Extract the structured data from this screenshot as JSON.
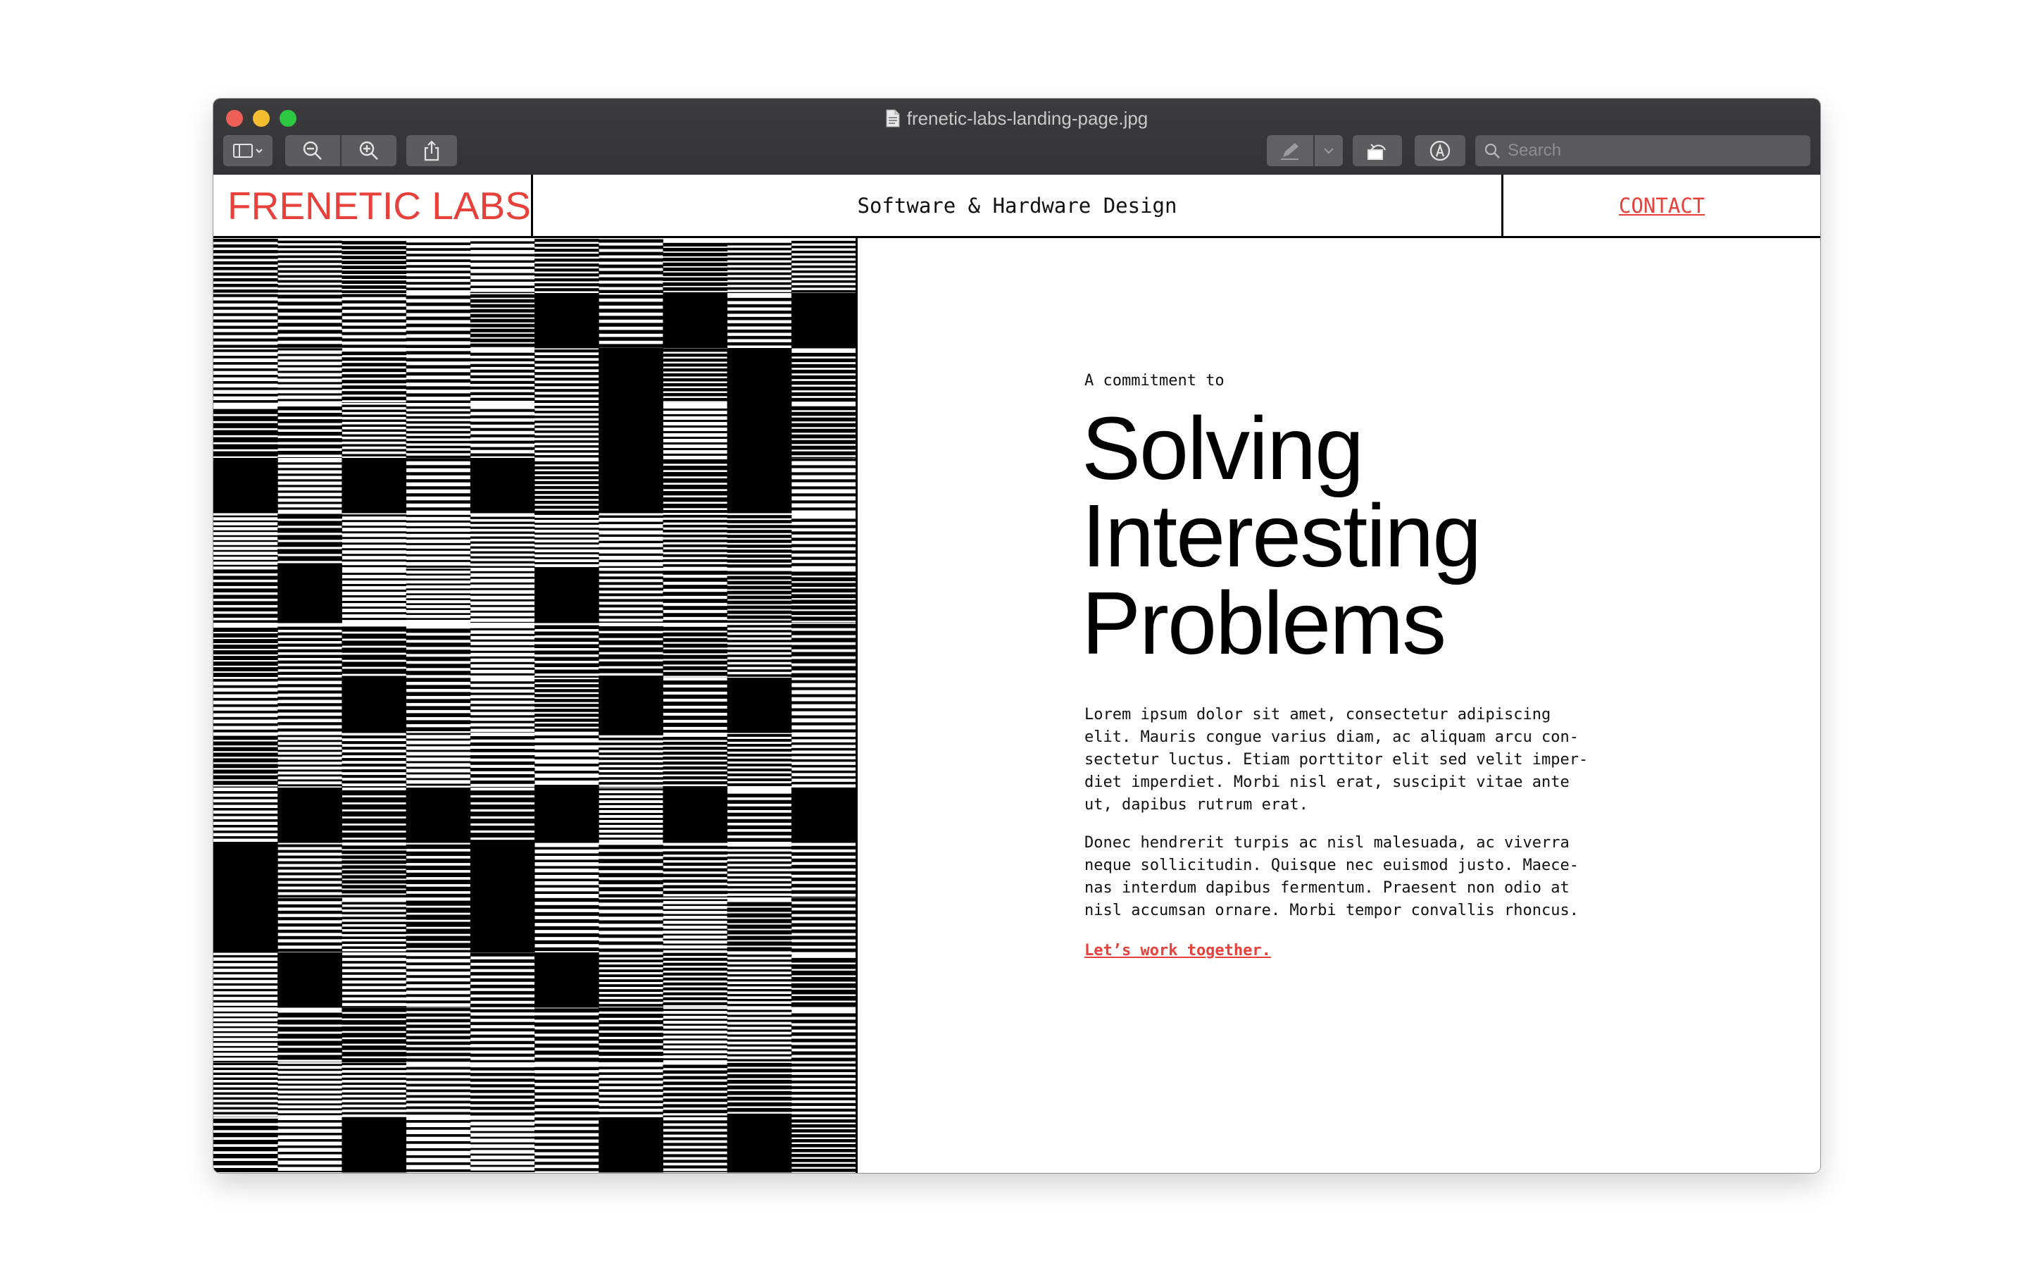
{
  "window": {
    "title": "frenetic-labs-landing-page.jpg"
  },
  "toolbar": {
    "search_placeholder": "Search"
  },
  "site": {
    "logo": "FRENETIC LABS",
    "tagline": "Software & Hardware Design",
    "contact": "CONTACT",
    "eyebrow": "A commitment to",
    "headline": [
      "Solving",
      "Interesting",
      "Problems"
    ],
    "paragraphs": [
      "Lorem ipsum dolor sit amet, consectetur adipiscing elit. Mauris congue varius diam, ac aliquam arcu con-sectetur luctus. Etiam porttitor elit sed velit imper-diet imperdiet. Morbi nisl erat, suscipit vitae ante ut, dapibus rutrum erat.",
      "Donec hendrerit turpis ac nisl malesuada, ac viverra neque sollicitudin. Quisque nec euismod justo. Maece-nas interdum dapibus fermentum. Praesent non odio at nisl accumsan ornare. Morbi tempor convallis rhoncus."
    ],
    "cta": "Let’s work together."
  },
  "colors": {
    "accent": "#e8413c",
    "titlebar": "#363638",
    "text": "#111111"
  }
}
